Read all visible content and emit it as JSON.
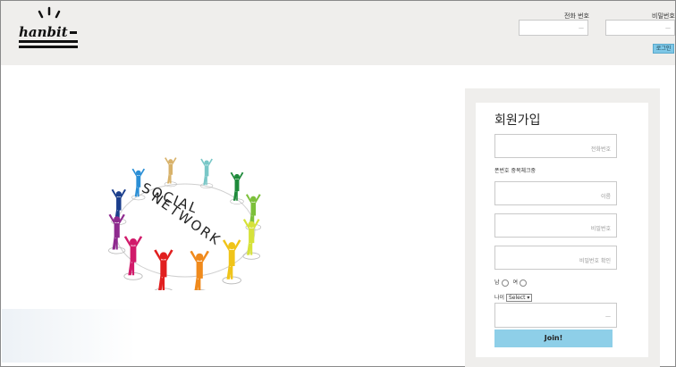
{
  "header": {
    "logo_text": "hanbit",
    "phone_label": "전화 번호",
    "phone_placeholder": "—",
    "password_label": "비밀번호",
    "password_placeholder": "—",
    "login_label": "로그인"
  },
  "signup": {
    "title": "회원가입",
    "phone_placeholder": "전화번호",
    "duplicate_note": "폰번호 중복체크중",
    "name_placeholder": "이름",
    "password_placeholder": "비밀번호",
    "password_confirm_placeholder": "비밀번호 확인",
    "gender_label": "남",
    "gender_female_label": "여",
    "age_label": "나이",
    "age_select": "Select ▾",
    "extra_placeholder": "—",
    "join_label": "Join!"
  },
  "graphic": {
    "word1": "SOCIAL",
    "word2": "NETWORK",
    "figure_colors": [
      "#1b3e8c",
      "#2b8fd6",
      "#d8b26a",
      "#79c7c7",
      "#1e8a3a",
      "#7cc03a",
      "#d6e23a",
      "#f0c419",
      "#f08a1c",
      "#e11f1f",
      "#d11a6a",
      "#8e2a8e"
    ]
  }
}
